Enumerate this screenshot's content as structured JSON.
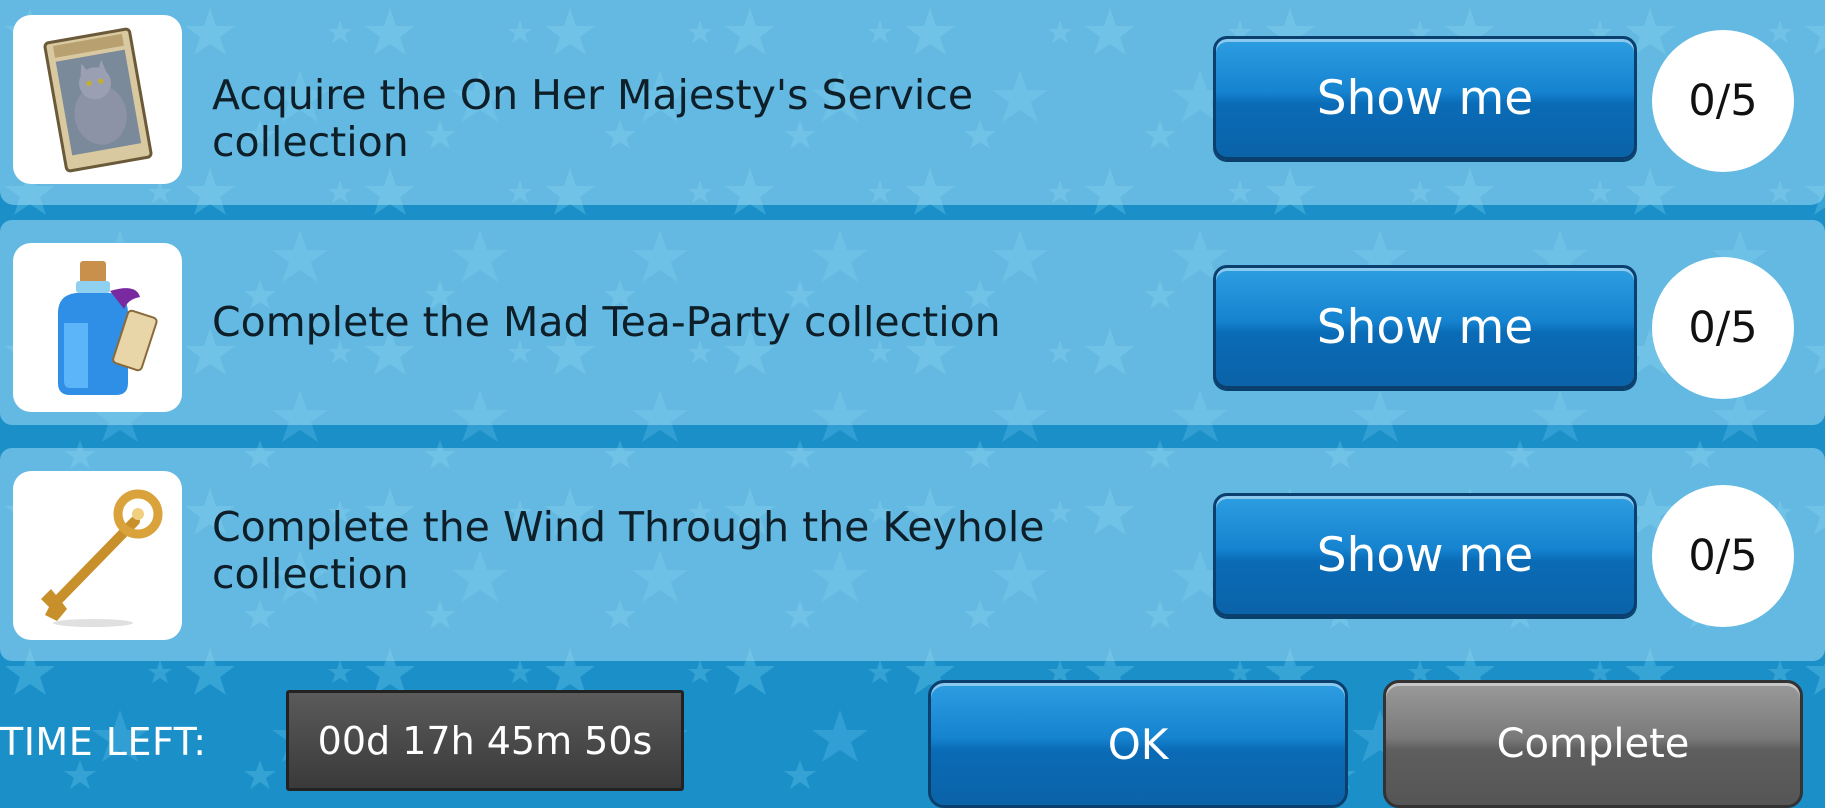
{
  "tasks": [
    {
      "text": "Acquire the On Her Majesty's Service collection",
      "button_label": "Show me",
      "progress": "0/5",
      "icon": "cat-portrait-card-icon"
    },
    {
      "text": "Complete the Mad Tea-Party collection",
      "button_label": "Show me",
      "progress": "0/5",
      "icon": "potion-bottle-icon"
    },
    {
      "text": "Complete the Wind Through the Keyhole collection",
      "button_label": "Show me",
      "progress": "0/5",
      "icon": "golden-key-icon"
    }
  ],
  "footer": {
    "time_label": "TIME LEFT:",
    "time_value": "00d 17h 45m 50s",
    "ok_label": "OK",
    "complete_label": "Complete"
  },
  "colors": {
    "background": "#1a8fc8",
    "button_blue": "#1583cf",
    "button_gray": "#7a7a7a"
  }
}
